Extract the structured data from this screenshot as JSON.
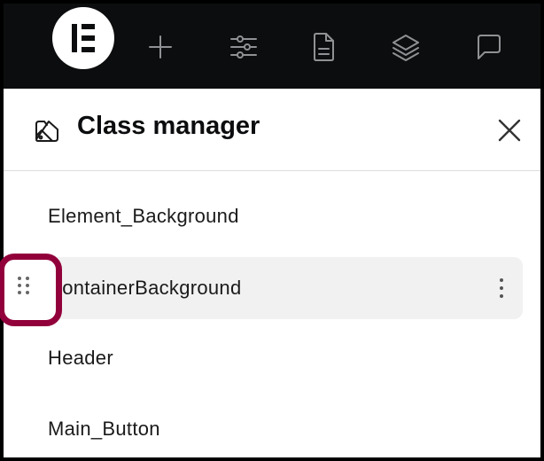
{
  "topbar": {
    "logo": "elementor-logo",
    "icons": [
      "plus-icon",
      "sliders-icon",
      "page-icon",
      "layers-icon",
      "comment-icon"
    ]
  },
  "panel": {
    "header_icon": "class-manager-icon",
    "title": "Class manager",
    "close_icon": "close-icon"
  },
  "classes": [
    {
      "label": "Element_Background",
      "hovered": false
    },
    {
      "label": "ContainerBackground",
      "hovered": true
    },
    {
      "label": "Header",
      "hovered": false
    },
    {
      "label": "Main_Button",
      "hovered": false
    }
  ],
  "colors": {
    "topbar_bg": "#0c0d0e",
    "icon_gray": "#8f9194",
    "hover_row_bg": "#f1f1f2",
    "highlight_ring": "#92003b"
  }
}
